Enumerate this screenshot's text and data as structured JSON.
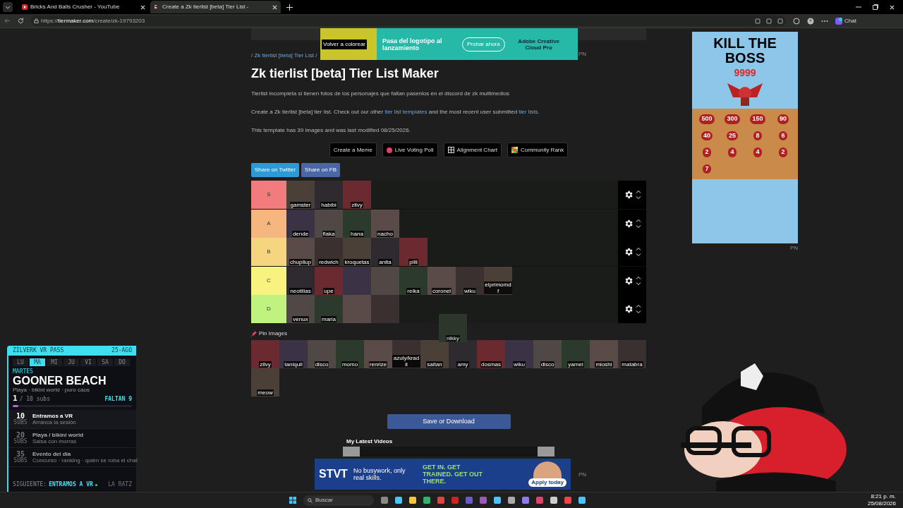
{
  "browser": {
    "tabs": [
      {
        "title": "Bricks And Balls Crusher - YouTube",
        "kind": "youtube",
        "selected": false
      },
      {
        "title": "Create a Zk tierlist [beta] Tier List -",
        "kind": "tiermaker",
        "selected": true
      }
    ],
    "url_scheme": "https://",
    "url_host": "tiermaker.com",
    "url_path": "/create/zk-19793203",
    "chat_label": "Chat"
  },
  "top_ad": {
    "badge": "Volver a colorear",
    "headline": "Pasa del logotipo al lanzamiento",
    "button": "Probar ahora",
    "brand": "Adobe Creative Cloud Pro",
    "mark": "PN"
  },
  "breadcrumb": "/ Zk tierlist [beta] Tier List /",
  "title": "Zk tierlist [beta] Tier List Maker",
  "description": "Tierlist incompleta si tienen fotos de los personajes que faltan pasenlos en el discord de zk multimedios",
  "intro": [
    {
      "text": "Create a Zk tierlist [beta] tier list. Check out our other ",
      "kind": "text"
    },
    {
      "text": "tier list templates",
      "kind": "link"
    },
    {
      "text": " and the most recent user submitted ",
      "kind": "text"
    },
    {
      "text": "tier lists",
      "kind": "link"
    },
    {
      "text": ".",
      "kind": "text"
    }
  ],
  "template_info": "This template has 39 images and was last modified 08/25/2026.",
  "actions": [
    {
      "label": "Create a Meme",
      "kind": "meme"
    },
    {
      "label": "Live Voting Poll",
      "kind": "poll"
    },
    {
      "label": "Alignment Chart",
      "kind": "alignment"
    },
    {
      "label": "Community Rank",
      "kind": "community"
    }
  ],
  "share": [
    {
      "label": "Share on Twitter",
      "kind": "twitter"
    },
    {
      "label": "Share on FB",
      "kind": "fb"
    }
  ],
  "tiers": [
    {
      "label": "S",
      "color": "#f07c7e",
      "items": [
        {
          "kind": "photo",
          "caption": "gamster"
        },
        {
          "kind": "photo",
          "caption": "habibi"
        },
        {
          "kind": "photo",
          "caption": "zilvy"
        }
      ]
    },
    {
      "label": "A",
      "color": "#f5b77f",
      "items": [
        {
          "kind": "photo",
          "caption": "dende"
        },
        {
          "kind": "photo",
          "caption": "flaka"
        },
        {
          "kind": "photo",
          "caption": "hana"
        },
        {
          "kind": "photo",
          "caption": "nacho"
        }
      ]
    },
    {
      "label": "B",
      "color": "#f5d57f",
      "items": [
        {
          "kind": "photo",
          "caption": "chupilup"
        },
        {
          "kind": "photo",
          "caption": "redwich"
        },
        {
          "kind": "photo",
          "caption": "kroquetas"
        },
        {
          "kind": "photo",
          "caption": "anita"
        },
        {
          "kind": "photo",
          "caption": "pilli"
        }
      ]
    },
    {
      "label": "C",
      "color": "#f8f27f",
      "items": [
        {
          "kind": "photo",
          "caption": "neotilias"
        },
        {
          "kind": "photo",
          "caption": "upe"
        },
        {
          "kind": "photo"
        },
        {
          "kind": "photo"
        },
        {
          "kind": "photo",
          "caption": "reika"
        },
        {
          "kind": "photo",
          "caption": "coronel"
        },
        {
          "kind": "photo",
          "caption": "wiku"
        },
        {
          "kind": "photo",
          "caption": "elprimomdf"
        }
      ]
    },
    {
      "label": "D",
      "color": "#c0f27f",
      "items": [
        {
          "kind": "photo",
          "caption": "venux"
        },
        {
          "kind": "photo",
          "caption": "maria"
        },
        {
          "kind": "photo"
        },
        {
          "kind": "photo"
        }
      ]
    }
  ],
  "dragged_item": {
    "kind": "photo",
    "caption": "nikky"
  },
  "pin_label": "Pin Images",
  "pool": [
    {
      "kind": "photo",
      "caption": "zilvy"
    },
    {
      "kind": "photo",
      "caption": "taniquil"
    },
    {
      "kind": "photo",
      "caption": "disco"
    },
    {
      "kind": "photo",
      "caption": "momo"
    },
    {
      "kind": "photo",
      "caption": "renrize"
    },
    {
      "kind": "photo",
      "caption": "azuly/kradii"
    },
    {
      "kind": "photo",
      "caption": "saitan"
    },
    {
      "kind": "photo",
      "caption": "amy"
    },
    {
      "kind": "photo",
      "caption": "dosmas"
    },
    {
      "kind": "photo",
      "caption": "wiku"
    },
    {
      "kind": "photo",
      "caption": "disco"
    },
    {
      "kind": "photo",
      "caption": "yamei"
    },
    {
      "kind": "photo",
      "caption": "mioshi"
    },
    {
      "kind": "photo",
      "caption": "matabra"
    },
    {
      "kind": "photo",
      "caption": "meow"
    }
  ],
  "save_button": "Save or Download",
  "videos_heading": "My Latest Videos",
  "side_ad": {
    "title": "KILL THE BOSS",
    "boss_value": "9999",
    "numbers": [
      "500",
      "300",
      "150",
      "90",
      "40",
      "25",
      "8",
      "6",
      "2",
      "4",
      "4",
      "2",
      "7"
    ],
    "mark": "PN"
  },
  "bottom_ad": {
    "logo": "STVT",
    "tagline": "No busywork, only real skills.",
    "slogan": "GET IN. GET TRAINED. GET OUT THERE.",
    "button": "Apply today",
    "mark": "PN"
  },
  "stream_widget": {
    "header": "ZILVERK VR PASS",
    "date": "25-AGO",
    "days": [
      {
        "label": "LU",
        "selected": false
      },
      {
        "label": "MA",
        "selected": true
      },
      {
        "label": "MI",
        "selected": false
      },
      {
        "label": "JU",
        "selected": false
      },
      {
        "label": "VI",
        "selected": false
      },
      {
        "label": "SA",
        "selected": false
      },
      {
        "label": "DO",
        "selected": false
      }
    ],
    "day_name": "MARTES",
    "event": "GOONER BEACH",
    "event_sub": "Playa · bikini world · puro caos",
    "count": "1",
    "goal": "/ 10 subs",
    "remaining": "FALTAN 9",
    "level": 0.05,
    "milestones": [
      {
        "number": "10",
        "unit": "SUBS",
        "title": "Entramos a VR",
        "subtitle": "Arranca la sesión",
        "active": true
      },
      {
        "number": "20",
        "unit": "SUBS",
        "title": "Playa / bikini world",
        "subtitle": "Salsa con morras",
        "active": false
      },
      {
        "number": "35",
        "unit": "SUBS",
        "title": "Evento del dia",
        "subtitle": "Concurso · ranking · quién se roba el chat",
        "active": false
      }
    ],
    "next_label": "SIGUIENTE:",
    "next_value": "ENTRAMOS A VR",
    "footer_right": "LA RATZ"
  },
  "taskbar": {
    "search": "Buscar",
    "time": "8:21 p. m.",
    "date": "25/08/2026"
  }
}
